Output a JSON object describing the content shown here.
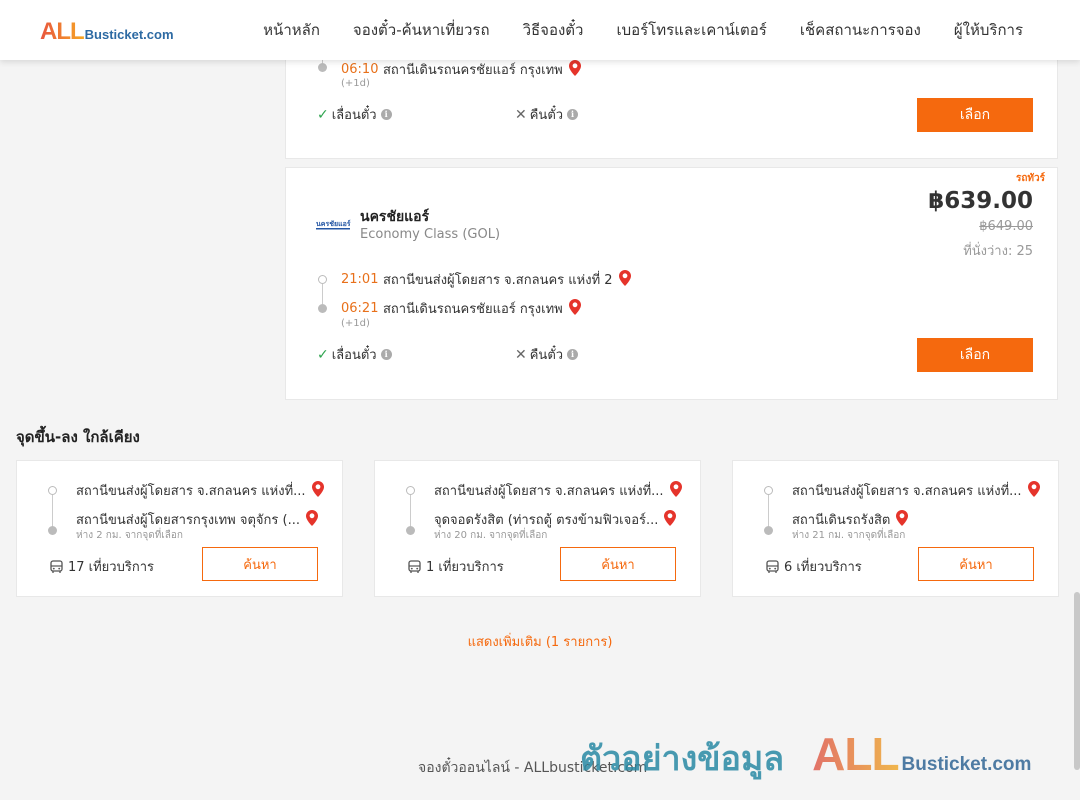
{
  "header": {
    "logo_all": "ALL",
    "logo_rest": "Busticket.com",
    "nav": [
      "หน้าหลัก",
      "จองตั๋ว-ค้นหาเที่ยวรถ",
      "วิธีจองตั๋ว",
      "เบอร์โทรและเคาน์เตอร์",
      "เช็คสถานะการจอง",
      "ผู้ให้บริการ"
    ]
  },
  "trips": [
    {
      "arrival_time": "06:10",
      "arrival_station": "สถานีเดินรถนครชัยแอร์ กรุงเทพ",
      "next_day": "(+1d)",
      "reschedule_label": "เลื่อนตั๋ว",
      "refund_label": "คืนตั๋ว",
      "select_label": "เลือก"
    },
    {
      "badge": "รถทัวร์",
      "operator_logo_text": "นครชัยแอร์",
      "operator": "นครชัยแอร์",
      "class": "Economy Class (GOL)",
      "price": "฿639.00",
      "old_price": "฿649.00",
      "seats": "ที่นั่งว่าง: 25",
      "departure_time": "21:01",
      "departure_station": "สถานีขนส่งผู้โดยสาร จ.สกลนคร แห่งที่ 2",
      "arrival_time": "06:21",
      "arrival_station": "สถานีเดินรถนครชัยแอร์ กรุงเทพ",
      "next_day": "(+1d)",
      "reschedule_label": "เลื่อนตั๋ว",
      "refund_label": "คืนตั๋ว",
      "select_label": "เลือก"
    }
  ],
  "nearby": {
    "title": "จุดขึ้น-ลง ใกล้เคียง",
    "cards": [
      {
        "from": "สถานีขนส่งผู้โดยสาร จ.สกลนคร แห่งที่...",
        "to": "สถานีขนส่งผู้โดยสารกรุงเทพ จตุจักร (...",
        "distance": "ห่าง 2 กม. จากจุดที่เลือก",
        "trips": "17 เที่ยวบริการ",
        "search_label": "ค้นหา"
      },
      {
        "from": "สถานีขนส่งผู้โดยสาร จ.สกลนคร แห่งที่...",
        "to": "จุดจอดรังสิต (ท่ารถตู้ ตรงข้ามฟิวเจอร์...",
        "distance": "ห่าง 20 กม. จากจุดที่เลือก",
        "trips": "1 เที่ยวบริการ",
        "search_label": "ค้นหา"
      },
      {
        "from": "สถานีขนส่งผู้โดยสาร จ.สกลนคร แห่งที่...",
        "to": "สถานีเดินรถรังสิต",
        "distance": "ห่าง 21 กม. จากจุดที่เลือก",
        "trips": "6 เที่ยวบริการ",
        "search_label": "ค้นหา"
      }
    ],
    "show_more": "แสดงเพิ่มเติม (1 รายการ)"
  },
  "footer": {
    "text": "จองตั๋วออนไลน์ - ALLbusticket.com"
  },
  "watermark": {
    "text": "ตัวอย่างข้อมูล",
    "all": "ALL",
    "rest": "Busticket.com"
  },
  "colors": {
    "accent": "#f5690e",
    "time": "#e8701a",
    "check": "#2ea44f",
    "pin": "#e5342b"
  },
  "icons": [
    "map-pin-icon",
    "check-icon",
    "x-icon",
    "info-icon",
    "bus-icon"
  ]
}
